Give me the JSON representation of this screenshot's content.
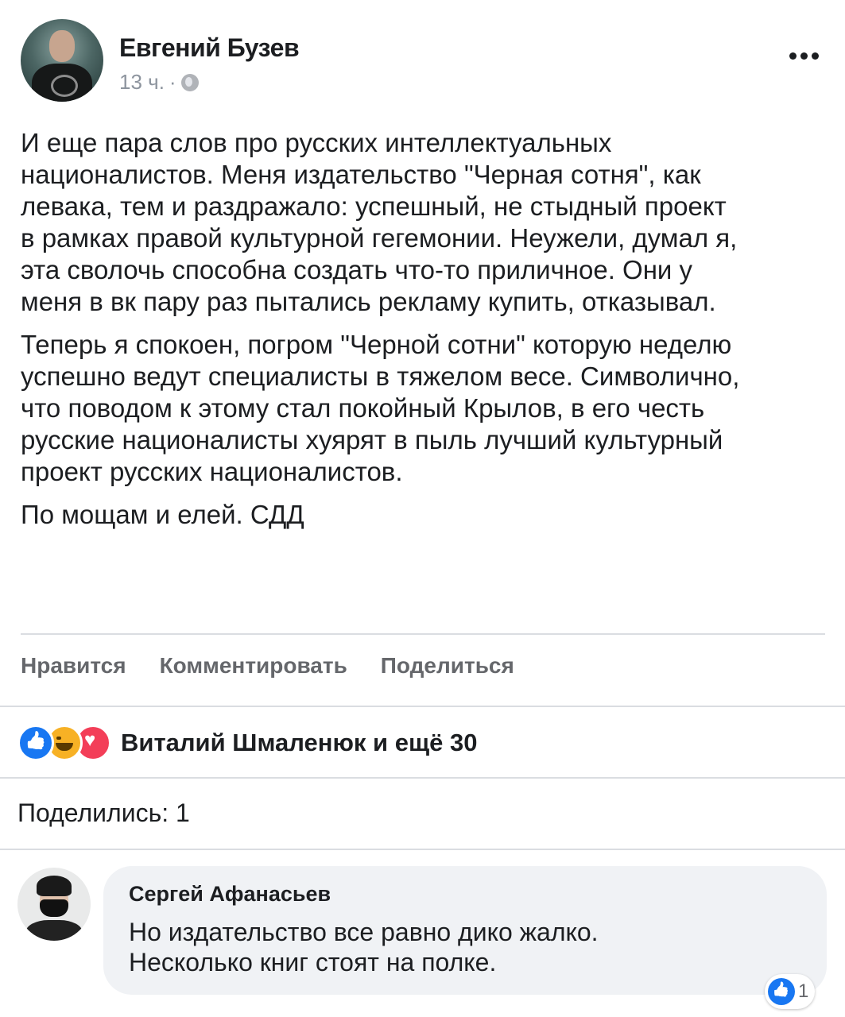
{
  "post": {
    "author": "Евгений Бузев",
    "time": "13 ч.",
    "separator": "·",
    "paragraphs": [
      "И еще пара слов про русских интеллектуальных\nнационалистов. Меня издательство \"Черная сотня\", как\nлевака, тем и раздражало: успешный, не стыдный проект\nв рамках правой культурной гегемонии. Неужели, думал я,\nэта сволочь способна создать что-то приличное. Они у\nменя в вк пару раз пытались рекламу купить, отказывал.",
      "Теперь я спокоен, погром \"Черной сотни\" которую неделю\nуспешно ведут специалисты в тяжелом весе. Символично,\nчто поводом к этому стал покойный Крылов, в его честь\nрусские националисты хуярят в пыль лучший культурный\nпроект русских националистов.",
      "По мощам и елей. СДД"
    ]
  },
  "actions": {
    "like": "Нравится",
    "comment": "Комментировать",
    "share": "Поделиться"
  },
  "reactions": {
    "icons": [
      "like-icon",
      "haha-icon",
      "love-icon"
    ],
    "text": "Виталий Шмаленюк и ещё 30"
  },
  "shares": "Поделились: 1",
  "comment": {
    "author": "Сергей Афанасьев",
    "text": "Но издательство все равно дико жалко.\nНесколько книг стоят на полке.",
    "likes": "1"
  },
  "colors": {
    "like_blue": "#1877f2",
    "haha_yellow": "#f7b125",
    "love_red": "#f33e58",
    "secondary_text": "#65676b",
    "bubble_bg": "#f0f2f5"
  }
}
